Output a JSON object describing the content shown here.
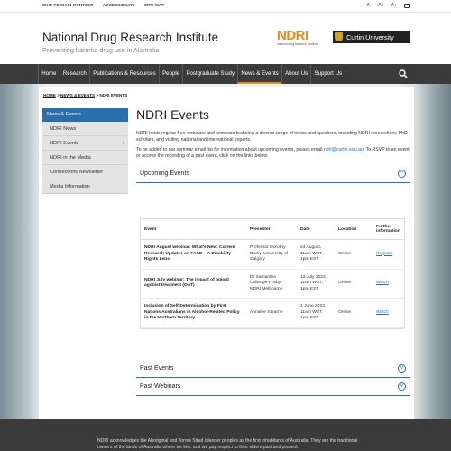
{
  "utility": {
    "links": [
      "SKIP TO MAIN CONTENT",
      "ACCESSIBILITY",
      "SITE MAP"
    ],
    "font_sizes": [
      "A-",
      "A+",
      "A+"
    ]
  },
  "header": {
    "title": "National Drug Research Institute",
    "tagline": "Preventing harmful drug use in Australia",
    "ndri_logo_text": "NDRI",
    "ndri_logo_sub": "national drug research institute",
    "curtin_logo_text": "Curtin University"
  },
  "nav": {
    "items": [
      "Home",
      "Research",
      "Publications & Resources",
      "People",
      "Postgraduate Study",
      "News & Events",
      "About Us",
      "Support Us"
    ]
  },
  "breadcrumb": {
    "home": "HOME",
    "sep": ">",
    "parent": "NEWS & EVENTS",
    "current": "NDRI EVENTS"
  },
  "sidebar": {
    "header": "News & Events",
    "items": [
      "NDRI News",
      "NDRI Events",
      "NDRI in the Media",
      "Connections Newsletter",
      "Media Information"
    ],
    "arrow": "›"
  },
  "content": {
    "title": "NDRI Events",
    "intro1": "NDRI hosts regular free webinars and seminars featuring a diverse range of topics and speakers, including NDRI researchers, PhD scholars, and visiting national and international experts.",
    "intro2_before": "To be added to our seminar email list for information about upcoming events, please email ",
    "intro2_email": "ndri@curtin.edu.au",
    "intro2_after": ". To RSVP to an event or access the recording of a past event, click on the links below.",
    "upcoming_label": "Upcoming Events",
    "past_events_label": "Past Events",
    "past_webinars_label": "Past Webinars",
    "icon_up": "^",
    "icon_down": "v"
  },
  "table": {
    "headers": [
      "Event",
      "Presenter",
      "Date",
      "Location",
      "Further information"
    ],
    "rows": [
      {
        "event": "NDRI August webinar: What's New: Current Research Updates on FASD – A Disability Rights Lens",
        "presenter": "Professor Dorothy Badry, University of Calgary",
        "date": "24 August, 11am WST, 1pm EST",
        "location": "Online",
        "info": "Register"
      },
      {
        "event": "NDRI July webinar: The impact of opioid agonist treatment (OAT)",
        "presenter": "Dr Samantha Colledge-Frisby, NDRI Melbourne",
        "date": "13 July 2022, 11am WST, 1pm EST",
        "location": "Online",
        "info": "Watch"
      },
      {
        "event": "Inclusion of Self-Determination by First Nations Australians in Alcohol-Related Policy in the Northern Territory",
        "presenter": "Annalee Stearne",
        "date": "1 June 2022, 11am WST, 1pm EST",
        "location": "Online",
        "info": "Watch"
      }
    ]
  },
  "footer": {
    "text": "NDRI acknowledges the Aboriginal and Torres Strait Islander peoples as the first inhabitants of Australia. They are the traditional owners of the lands of Australia where we live, and we pay respect to their elders past and present."
  },
  "colors": {
    "accent_blue": "#2a6fad",
    "ndri_orange": "#f08a1c",
    "nav_bg": "#3b3b3b"
  }
}
